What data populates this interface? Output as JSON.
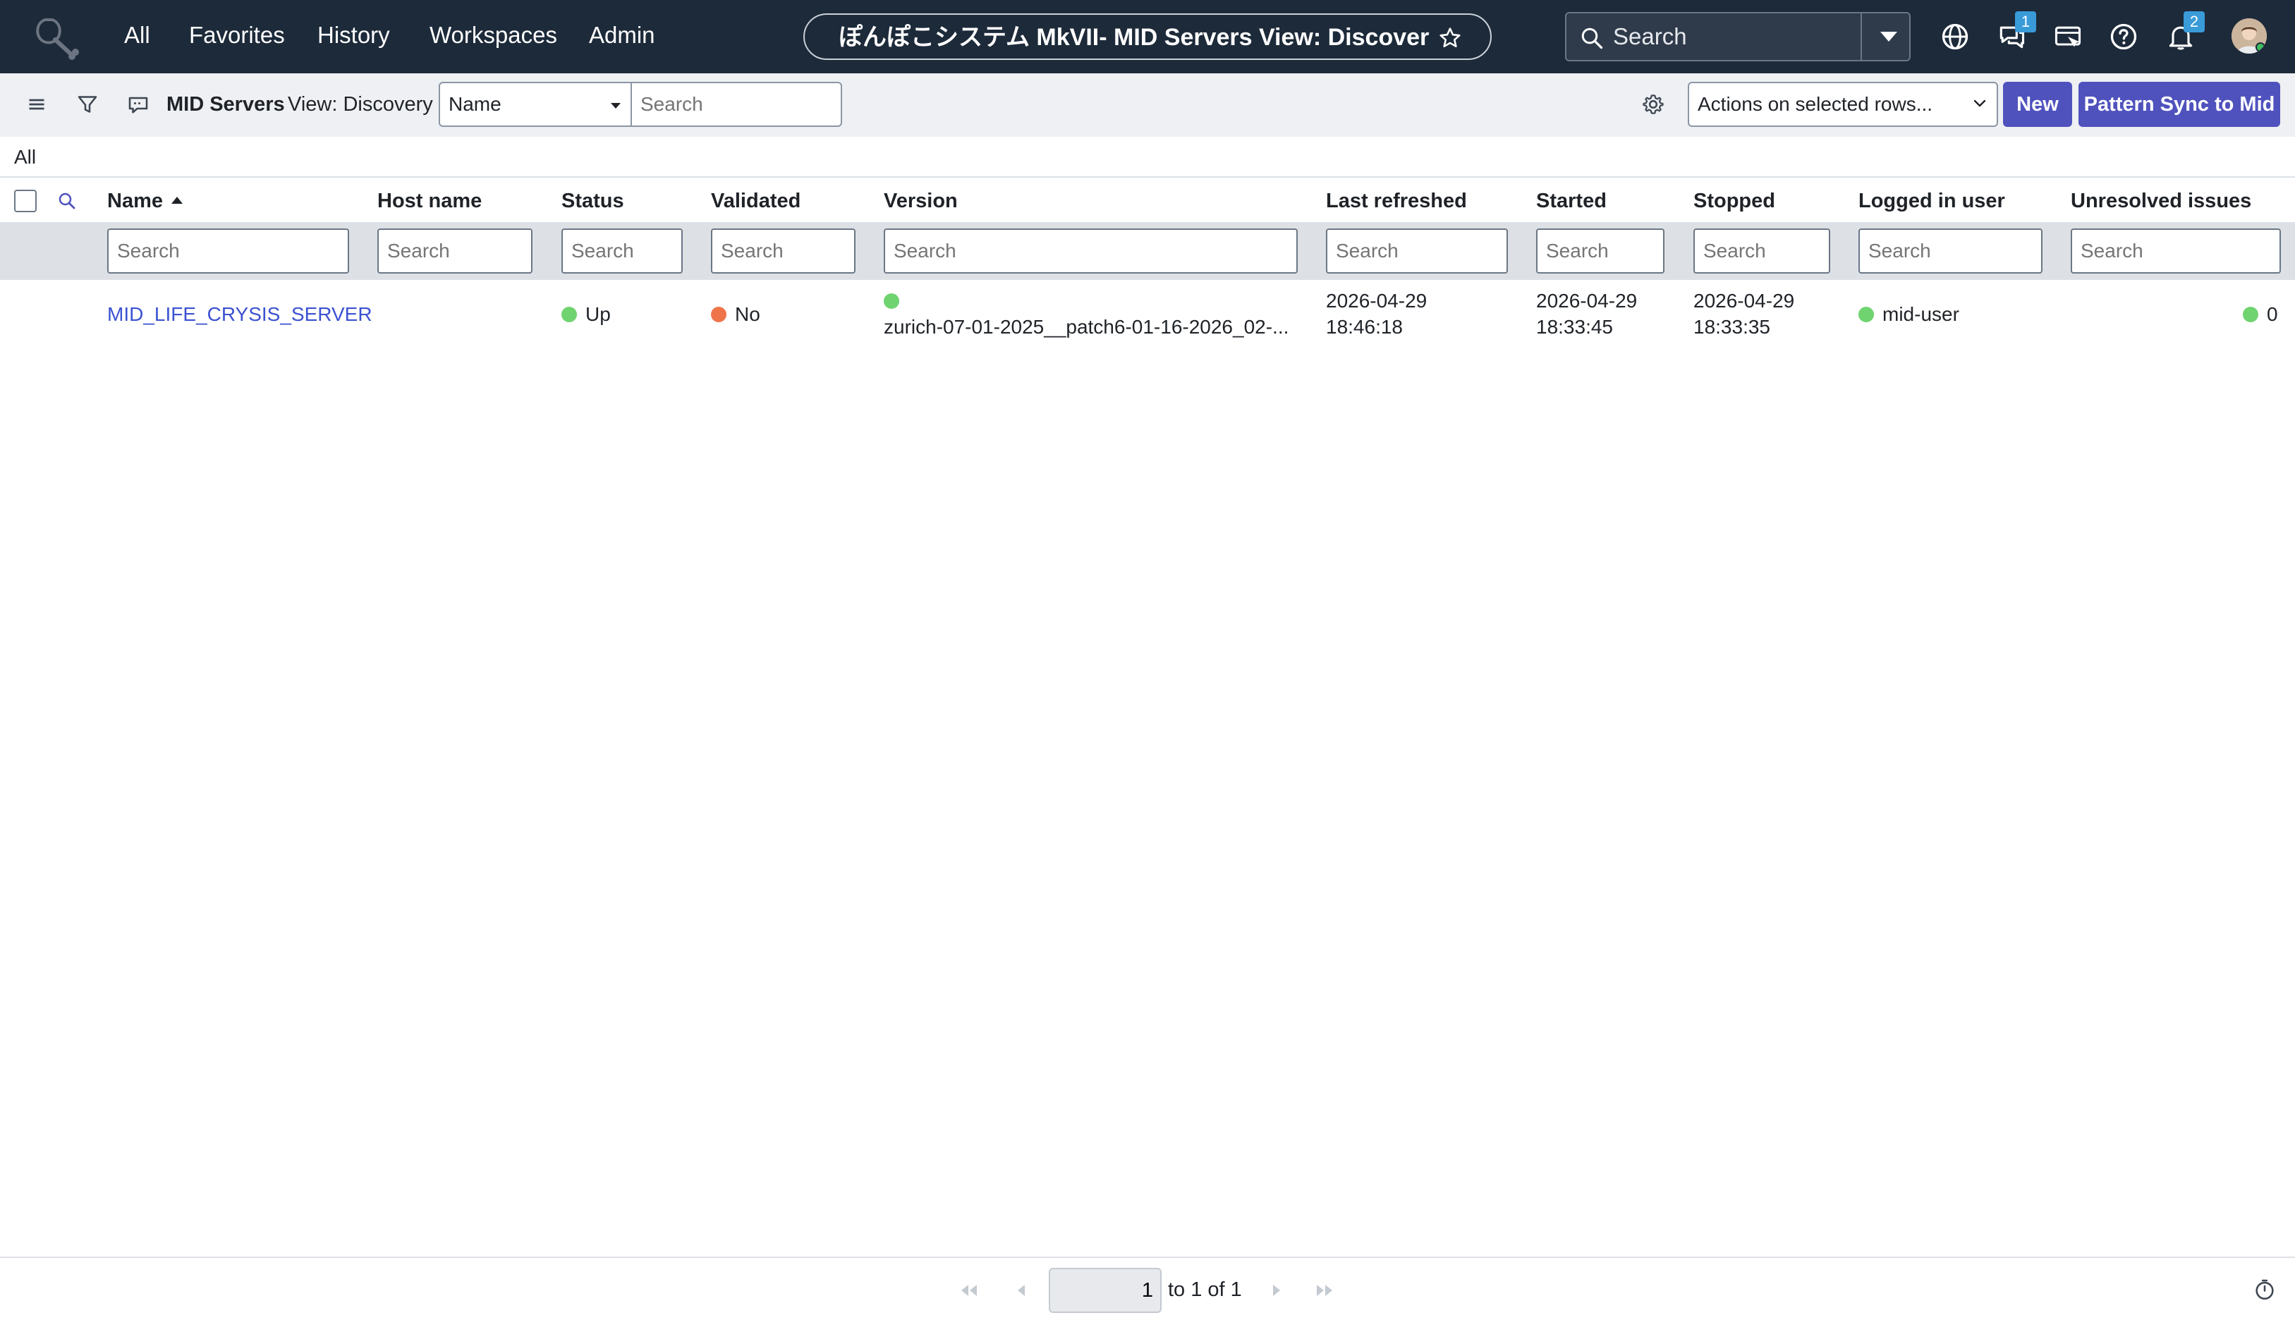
{
  "topnav": {
    "items": [
      "All",
      "Favorites",
      "History",
      "Workspaces",
      "Admin"
    ],
    "title": "ぽんぽこシステム MkVII- MID Servers View: Discovery | ...",
    "search_placeholder": "Search",
    "chat_badge": "1",
    "notification_badge": "2",
    "icons": [
      "globe-icon",
      "chat-icon",
      "screen-icon",
      "help-icon",
      "bell-icon"
    ]
  },
  "list_header": {
    "title": "MID Servers",
    "view": "View: Discovery",
    "search_field": "Name",
    "search_placeholder": "Search",
    "actions_select": "Actions on selected rows...",
    "new_button": "New",
    "pattern_sync_button": "Pattern Sync to Mid"
  },
  "breadcrumb": "All",
  "table": {
    "columns": [
      "Name",
      "Host name",
      "Status",
      "Validated",
      "Version",
      "Last refreshed",
      "Started",
      "Stopped",
      "Logged in user",
      "Unresolved issues"
    ],
    "filter_placeholder": "Search",
    "sorted_column": "Name",
    "rows": [
      {
        "name": "MID_LIFE_CRYSIS_SERVER",
        "host_name": "",
        "status": "Up",
        "validated": "No",
        "version": "zurich-07-01-2025__patch6-01-16-2026_02-...",
        "last_refreshed_date": "2026-04-29",
        "last_refreshed_time": "18:46:18",
        "started_date": "2026-04-29",
        "started_time": "18:33:45",
        "stopped_date": "2026-04-29",
        "stopped_time": "18:33:35",
        "logged_in_user": "mid-user",
        "unresolved_issues": "0"
      }
    ]
  },
  "pagination": {
    "current_page": "1",
    "to_text": "to 1 of 1"
  },
  "colors": {
    "nav_bg": "#1d2a3a",
    "accent": "#4f52bd",
    "link": "#3b52d1",
    "status_green": "#6fd36f",
    "status_orange": "#f0744a"
  }
}
